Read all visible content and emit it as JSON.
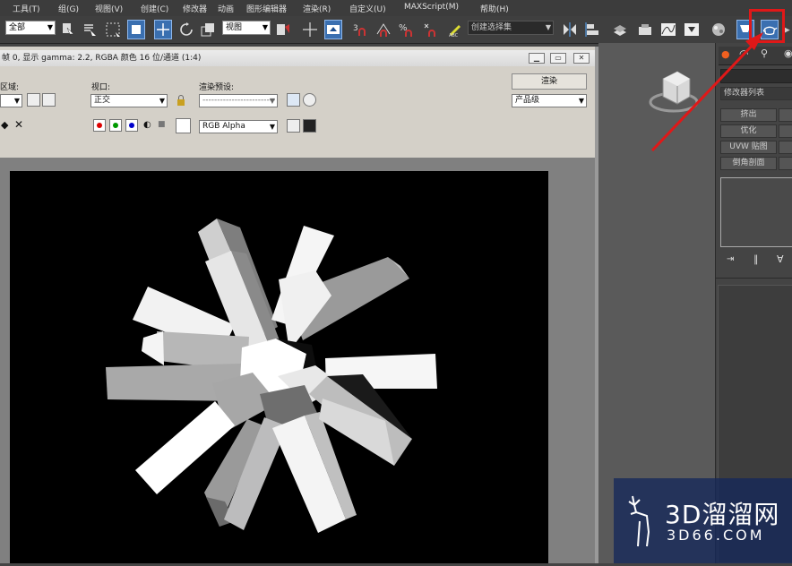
{
  "menu": [
    "工具(T)",
    "组(G)",
    "视图(V)",
    "创建(C)",
    "修改器",
    "动画",
    "图形编辑器",
    "渲染(R)",
    "自定义(U)",
    "MAXScript(M)",
    "帮助(H)"
  ],
  "toolbar": {
    "selection_filter": "全部",
    "reference_coord": "视图",
    "named_selection": "创建选择集"
  },
  "render_window": {
    "title": "帧 0, 显示 gamma: 2.2, RGBA 颜色 16 位/通道 (1:4)",
    "area_label": "区域:",
    "viewport_label": "视口:",
    "viewport_value": "正交",
    "preset_label": "渲染预设:",
    "preset_value": "-------------------------",
    "render_button": "渲染",
    "quality_value": "产品级",
    "channel_value": "RGB Alpha"
  },
  "command_panel": {
    "modifier_list": "修改器列表",
    "buttons": [
      "挤出",
      "优化",
      "UVW 贴图",
      "倒角剖面"
    ]
  },
  "watermark": {
    "brand": "3D溜溜网",
    "url": "3D66.COM"
  },
  "colors": {
    "highlight": "#e01818",
    "active_button": "#3a6fb0"
  }
}
